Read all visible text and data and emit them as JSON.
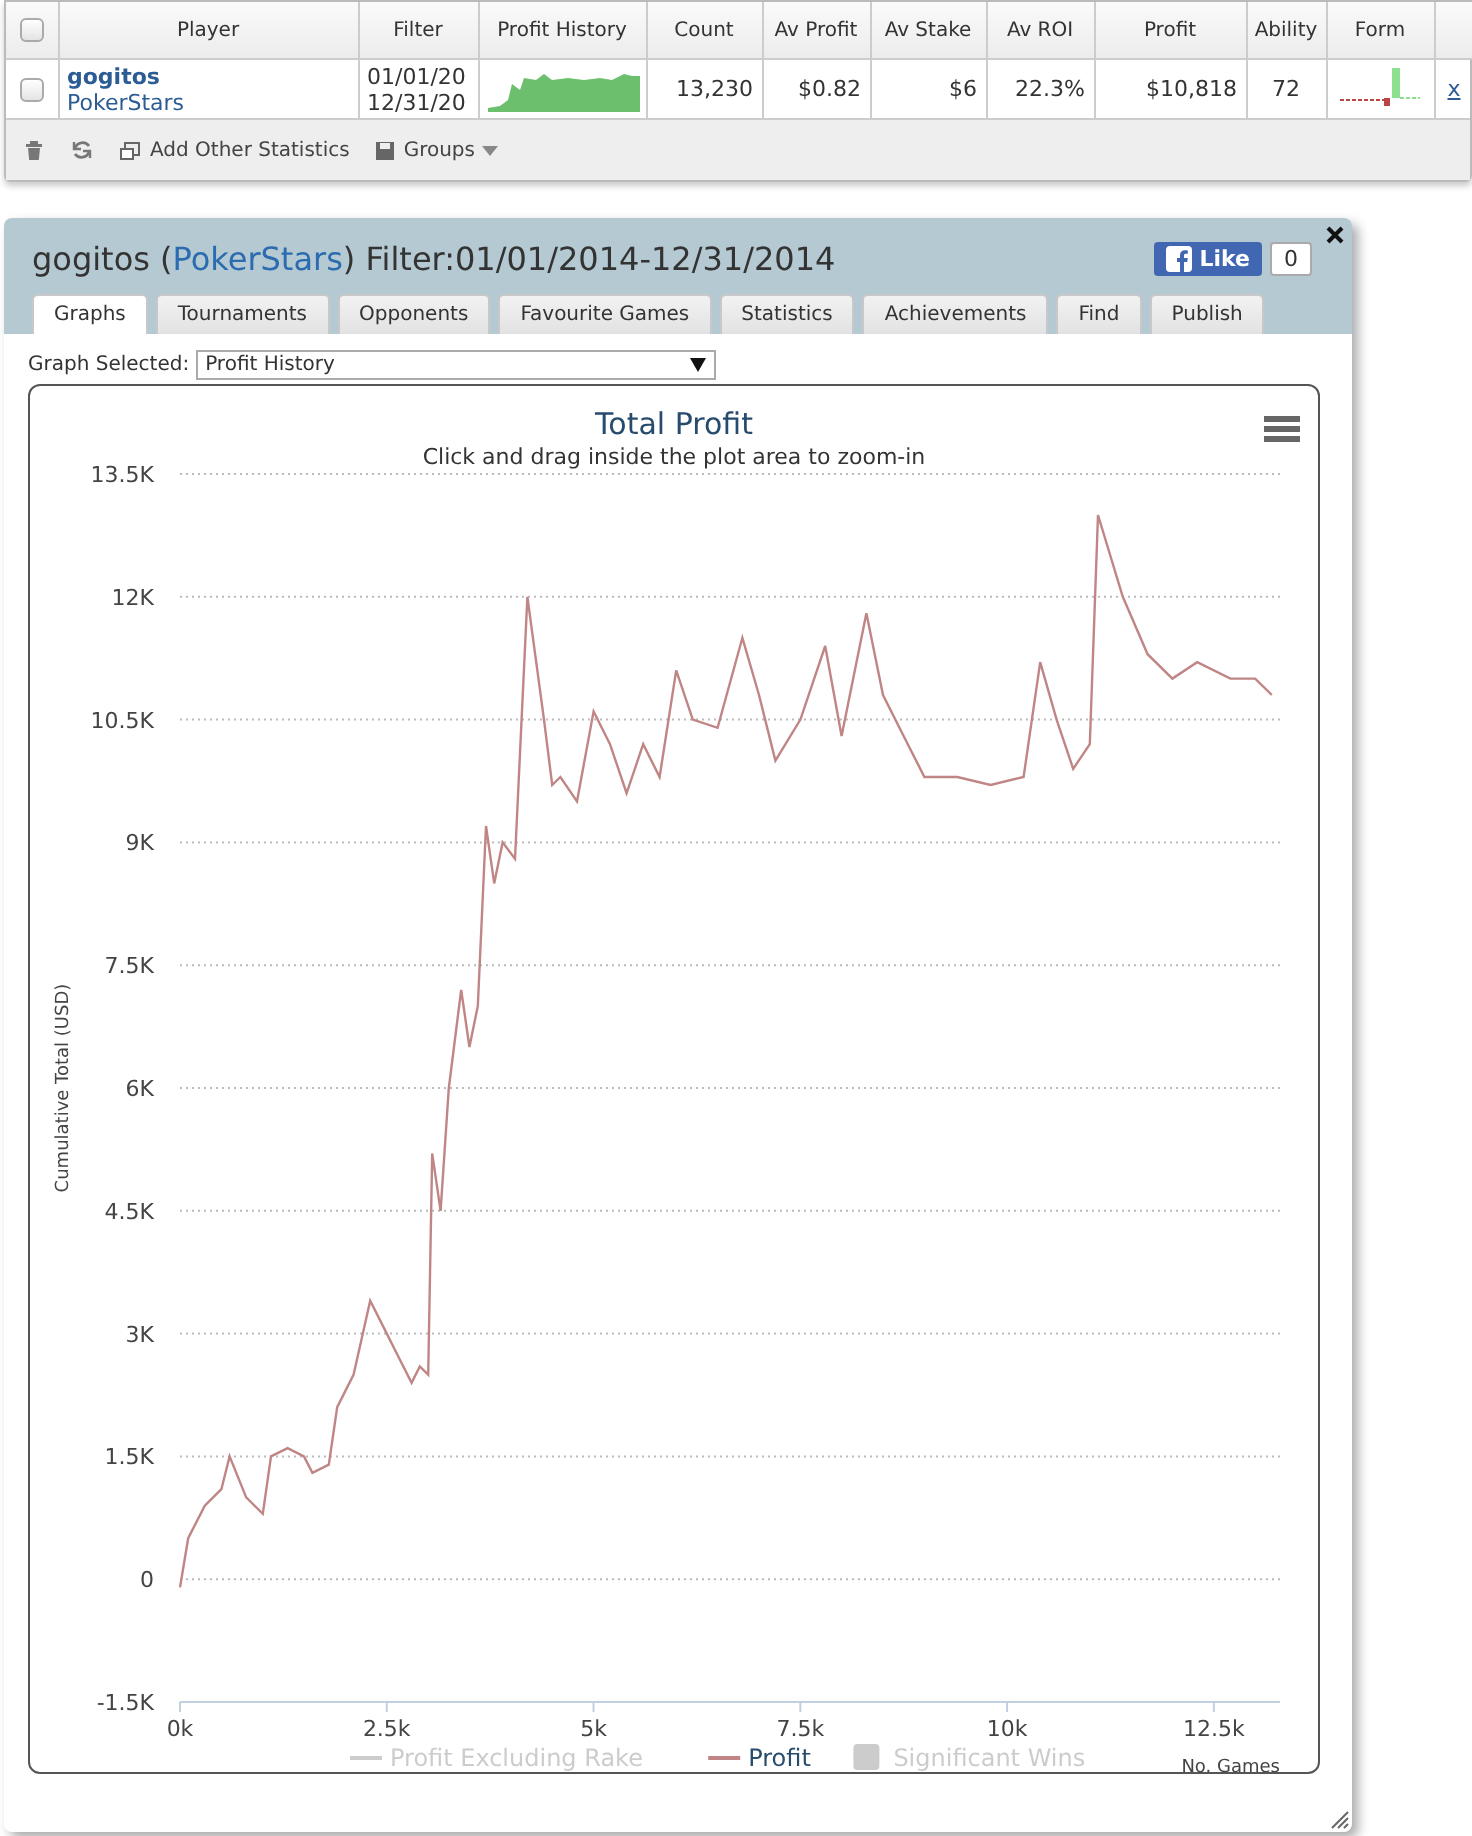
{
  "results_table": {
    "columns": [
      "Player",
      "Filter",
      "Profit History",
      "Count",
      "Av Profit",
      "Av Stake",
      "Av ROI",
      "Profit",
      "Ability",
      "Form"
    ],
    "rows": [
      {
        "checked": false,
        "player": "gogitos",
        "site": "PokerStars",
        "filter": [
          "01/01/20",
          "12/31/20"
        ],
        "count": "13,230",
        "av_profit": "$0.82",
        "av_stake": "$6",
        "av_roi": "22.3%",
        "profit": "$10,818",
        "ability": "72",
        "remove": "x"
      }
    ],
    "header_checked": false,
    "toolbar": [
      {
        "kind": "delete"
      },
      {
        "kind": "refresh"
      },
      {
        "kind": "add",
        "label": "Add Other Statistics"
      },
      {
        "kind": "groups",
        "label": "Groups"
      }
    ]
  },
  "panel": {
    "title_prefix": "gogitos (",
    "site": "PokerStars",
    "title_suffix": ") Filter:01/01/2014-12/31/2014",
    "like_label": "Like",
    "like_count": "0",
    "tabs": [
      {
        "label": "Graphs",
        "selected": true
      },
      {
        "label": "Tournaments",
        "selected": false
      },
      {
        "label": "Opponents",
        "selected": false
      },
      {
        "label": "Favourite Games",
        "selected": false
      },
      {
        "label": "Statistics",
        "selected": false
      },
      {
        "label": "Achievements",
        "selected": false
      },
      {
        "label": "Find",
        "selected": false
      },
      {
        "label": "Publish",
        "selected": false
      }
    ],
    "graph_selected_label": "Graph Selected:",
    "graph_selected_value": "Profit History",
    "chart": {
      "subtitle": "Click and drag inside the plot area to zoom-in",
      "legend": [
        {
          "label": "Profit Excluding Rake",
          "kind": "line",
          "color": "#cccccc",
          "visible": false
        },
        {
          "kind": "series",
          "visible": true
        },
        {
          "label": "Significant Wins",
          "kind": "box",
          "color": "#cccccc",
          "visible": false
        }
      ],
      "chart_data": {
        "type": "line",
        "title": "Total Profit",
        "xlabel": "No. Games",
        "ylabel": "Cumulative Total (USD)",
        "x": [
          0,
          100,
          300,
          500,
          600,
          800,
          1000,
          1100,
          1300,
          1500,
          1600,
          1800,
          1900,
          2100,
          2300,
          2500,
          2600,
          2800,
          2900,
          3000,
          3050,
          3150,
          3250,
          3400,
          3500,
          3600,
          3700,
          3800,
          3900,
          4050,
          4200,
          4400,
          4500,
          4600,
          4800,
          5000,
          5200,
          5400,
          5600,
          5800,
          6000,
          6200,
          6500,
          6800,
          7000,
          7200,
          7500,
          7800,
          8000,
          8300,
          8500,
          8800,
          9000,
          9400,
          9800,
          10200,
          10400,
          10600,
          10800,
          11000,
          11100,
          11400,
          11700,
          12000,
          12300,
          12700,
          13000,
          13200
        ],
        "series": [
          {
            "name": "Profit",
            "color": "#c08585",
            "values": [
              -100,
              500,
              900,
              1100,
              1500,
              1000,
              800,
              1500,
              1600,
              1500,
              1300,
              1400,
              2100,
              2500,
              3400,
              3000,
              2800,
              2400,
              2600,
              2500,
              5200,
              4500,
              6000,
              7200,
              6500,
              7000,
              9200,
              8500,
              9000,
              8800,
              12000,
              10500,
              9700,
              9800,
              9500,
              10600,
              10200,
              9600,
              10200,
              9800,
              11100,
              10500,
              10400,
              11500,
              10800,
              10000,
              10500,
              11400,
              10300,
              11800,
              10800,
              10200,
              9800,
              9800,
              9700,
              9800,
              11200,
              10500,
              9900,
              10200,
              13000,
              12000,
              11300,
              11000,
              11200,
              11000,
              11000,
              10800
            ]
          }
        ],
        "grid": true,
        "xlim": [
          0,
          13300
        ],
        "ylim": [
          -1500,
          13500
        ],
        "xticks": [
          {
            "value": 0,
            "label": "0k"
          },
          {
            "value": 2500,
            "label": "2.5k"
          },
          {
            "value": 5000,
            "label": "5k"
          },
          {
            "value": 7500,
            "label": "7.5k"
          },
          {
            "value": 10000,
            "label": "10k"
          },
          {
            "value": 12500,
            "label": "12.5k"
          }
        ],
        "yticks": [
          {
            "value": -1500,
            "label": "-1.5K"
          },
          {
            "value": 0,
            "label": "0"
          },
          {
            "value": 1500,
            "label": "1.5K"
          },
          {
            "value": 3000,
            "label": "3K"
          },
          {
            "value": 4500,
            "label": "4.5K"
          },
          {
            "value": 6000,
            "label": "6K"
          },
          {
            "value": 7500,
            "label": "7.5K"
          },
          {
            "value": 9000,
            "label": "9K"
          },
          {
            "value": 10500,
            "label": "10.5K"
          },
          {
            "value": 12000,
            "label": "12K"
          },
          {
            "value": 13500,
            "label": "13.5K"
          }
        ]
      }
    }
  }
}
